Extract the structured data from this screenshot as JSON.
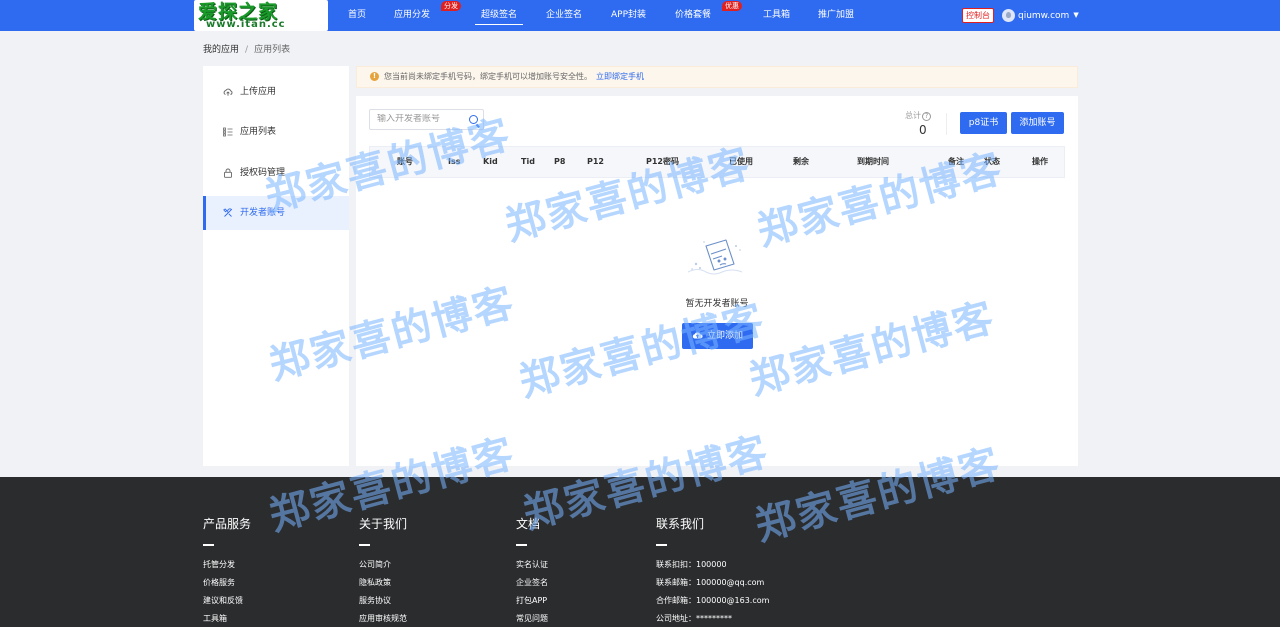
{
  "brand": {
    "logo_text": "爱探之家",
    "logo_url": "www.itan.cc"
  },
  "nav": {
    "items": [
      {
        "label": "首页"
      },
      {
        "label": "应用分发",
        "badge": "分发"
      },
      {
        "label": "超级签名",
        "active": true
      },
      {
        "label": "企业签名"
      },
      {
        "label": "APP封装"
      },
      {
        "label": "价格套餐",
        "badge": "优惠"
      },
      {
        "label": "工具箱"
      },
      {
        "label": "推广加盟"
      }
    ],
    "console_label": "控制台",
    "username": "qiumw.com"
  },
  "breadcrumb": {
    "root": "我的应用",
    "separator": "/",
    "current": "应用列表"
  },
  "sidebar": {
    "items": [
      {
        "label": "上传应用",
        "icon": "cloud-upload-icon"
      },
      {
        "label": "应用列表",
        "icon": "list-icon"
      },
      {
        "label": "授权码管理",
        "icon": "lock-icon"
      },
      {
        "label": "开发者账号",
        "icon": "tools-icon",
        "active": true
      }
    ]
  },
  "alert": {
    "text": "您当前尚未绑定手机号码，绑定手机可以增加账号安全性。",
    "link": "立即绑定手机",
    "color": "#e6a23c"
  },
  "main": {
    "search_placeholder": "输入开发者账号",
    "total_label": "总计",
    "total_value": "0",
    "p8_button": "p8证书",
    "add_account_button": "添加账号",
    "columns": [
      "账号",
      "Iss",
      "Kid",
      "Tid",
      "P8",
      "P12",
      "P12密码",
      "已使用",
      "剩余",
      "到期时间",
      "备注",
      "状态",
      "操作"
    ],
    "empty_text": "暂无开发者账号",
    "add_now_button": "立即添加"
  },
  "footer": {
    "columns": [
      {
        "title": "产品服务",
        "links": [
          "托管分发",
          "价格服务",
          "建议和反馈",
          "工具箱"
        ]
      },
      {
        "title": "关于我们",
        "links": [
          "公司简介",
          "隐私政策",
          "服务协议",
          "应用审核规范"
        ]
      },
      {
        "title": "文档",
        "links": [
          "实名认证",
          "企业签名",
          "打包APP",
          "常见问题"
        ]
      },
      {
        "title": "联系我们",
        "links": [
          "联系扣扣：100000",
          "联系邮箱：100000@qq.com",
          "合作邮箱：100000@163.com",
          "公司地址：*********"
        ]
      }
    ]
  },
  "watermark": "郑家喜的博客",
  "colors": {
    "primary": "#2f6bf0",
    "footer_bg": "#2b2c2e",
    "badge_red": "#e02020"
  }
}
